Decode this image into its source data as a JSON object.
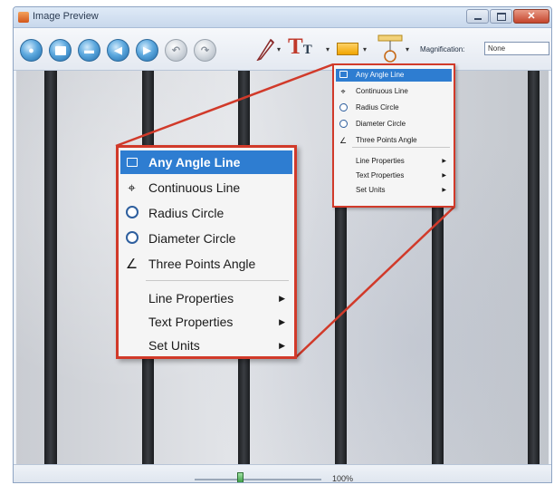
{
  "window": {
    "title": "Image Preview"
  },
  "toolbar": {
    "buttons": [
      {
        "name": "capture-button"
      },
      {
        "name": "new-document-button"
      },
      {
        "name": "save-button"
      },
      {
        "name": "back-button"
      },
      {
        "name": "forward-button"
      },
      {
        "name": "undo-button"
      },
      {
        "name": "redo-button"
      }
    ],
    "magnification_label": "Magnification:",
    "magnification_value": "None"
  },
  "measure_menu_small": {
    "items": [
      "Any Angle Line",
      "Continuous Line",
      "Radius Circle",
      "Diameter Circle",
      "Three Points Angle"
    ],
    "submenus": [
      "Line Properties",
      "Text Properties",
      "Set Units"
    ],
    "highlighted": "Any Angle Line"
  },
  "measure_menu_large": {
    "items": [
      "Any Angle Line",
      "Continuous Line",
      "Radius Circle",
      "Diameter Circle",
      "Three Points Angle"
    ],
    "submenus": [
      "Line Properties",
      "Text Properties",
      "Set Units"
    ],
    "highlighted": "Any Angle Line"
  },
  "status": {
    "zoom": "100%"
  },
  "colors": {
    "callout": "#d13a2a",
    "highlight": "#2e7dd1"
  },
  "icons": {
    "any_angle_line": "line-icon",
    "continuous_line": "continuous-line-icon",
    "radius_circle": "radius-circle-icon",
    "diameter_circle": "diameter-circle-icon",
    "three_points_angle": "angle-icon",
    "submenu_arrow": "chevron-right-icon"
  }
}
